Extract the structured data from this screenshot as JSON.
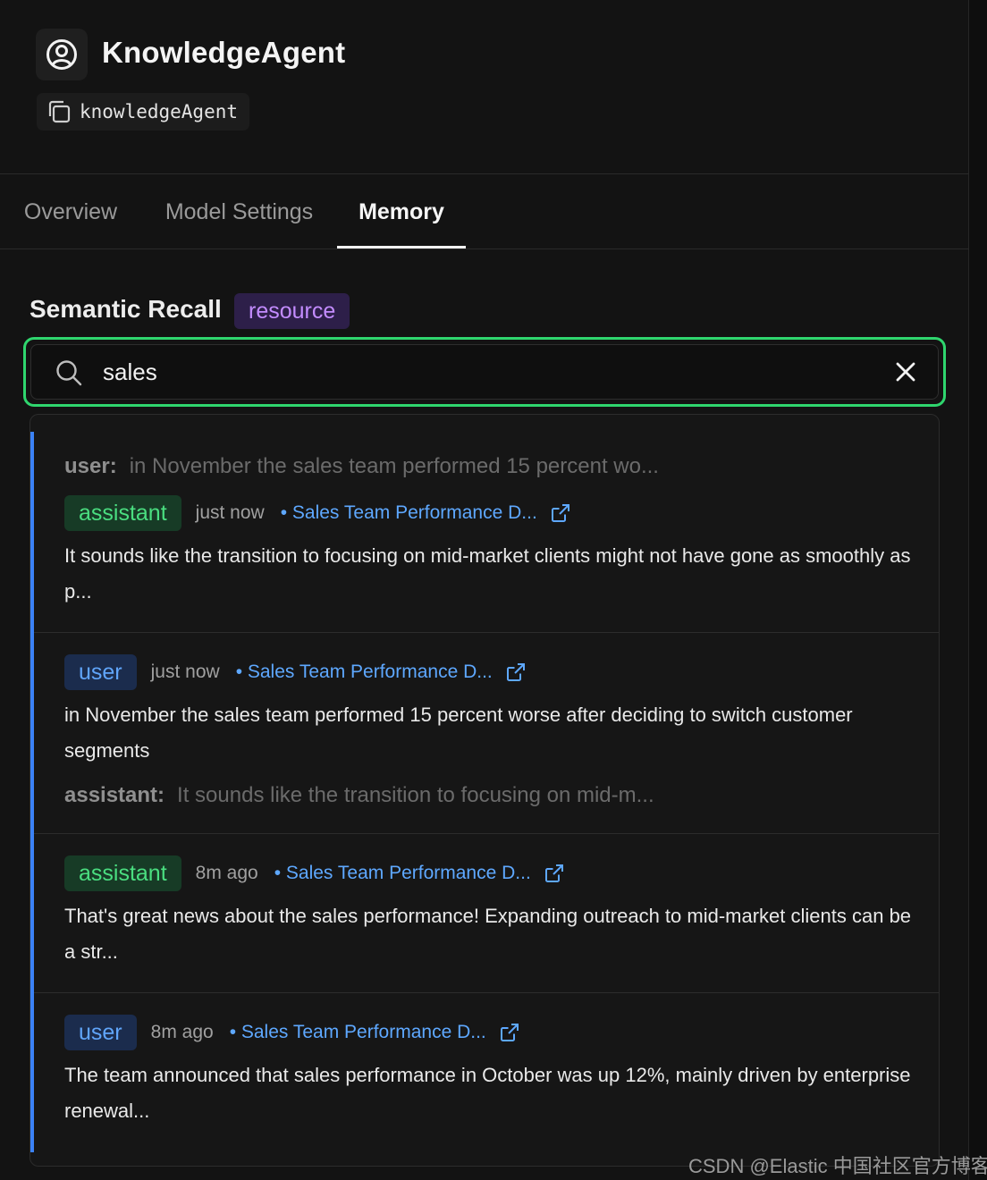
{
  "agent": {
    "title": "KnowledgeAgent",
    "id": "knowledgeAgent"
  },
  "tabs": [
    {
      "label": "Overview"
    },
    {
      "label": "Model Settings"
    },
    {
      "label": "Memory",
      "active": true
    }
  ],
  "semantic_recall": {
    "title": "Semantic Recall",
    "scope_badge": "resource"
  },
  "search": {
    "value": "sales"
  },
  "results": [
    {
      "context_before": {
        "role": "user:",
        "text": "in November the sales team performed 15 percent wo..."
      },
      "role": "assistant",
      "time": "just now",
      "thread": "• Sales Team Performance D...",
      "text": "It sounds like the transition to focusing on mid-market clients might not have gone as smoothly as p..."
    },
    {
      "role": "user",
      "time": "just now",
      "thread": "• Sales Team Performance D...",
      "text": "in November the sales team performed 15 percent worse after deciding to switch customer segments",
      "context_after": {
        "role": "assistant:",
        "text": "It sounds like the transition to focusing on mid-m..."
      }
    },
    {
      "role": "assistant",
      "time": "8m ago",
      "thread": "• Sales Team Performance D...",
      "text": "That's great news about the sales performance! Expanding outreach to mid-market clients can be a str..."
    },
    {
      "role": "user",
      "time": "8m ago",
      "thread": "• Sales Team Performance D...",
      "text": "The team announced that sales performance in October was up 12%, mainly driven by enterprise renewal..."
    }
  ],
  "watermark": "CSDN @Elastic 中国社区官方博客",
  "colors": {
    "accent_green": "#2fd66e",
    "assistant_badge_text": "#4ade80",
    "user_badge_text": "#60a5fa",
    "link": "#5ea8ff",
    "scope_badge_text": "#c38cff",
    "result_accent": "#3b82f6"
  },
  "icons": {
    "agent": "user-circle-icon",
    "copy": "copy-icon",
    "search": "search-icon",
    "clear": "close-icon",
    "external_link": "external-link-icon"
  }
}
